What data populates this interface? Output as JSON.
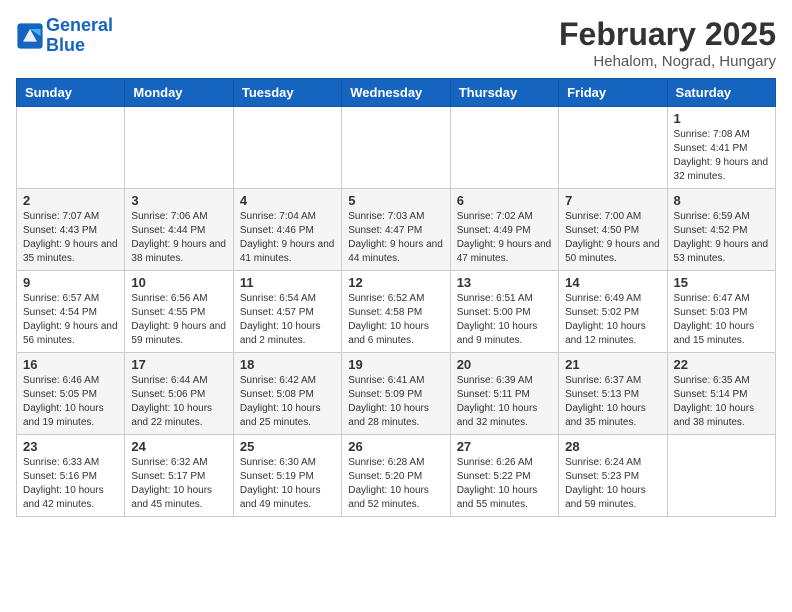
{
  "header": {
    "logo_line1": "General",
    "logo_line2": "Blue",
    "title": "February 2025",
    "subtitle": "Hehalom, Nograd, Hungary"
  },
  "days_of_week": [
    "Sunday",
    "Monday",
    "Tuesday",
    "Wednesday",
    "Thursday",
    "Friday",
    "Saturday"
  ],
  "weeks": [
    [
      {
        "day": "",
        "info": ""
      },
      {
        "day": "",
        "info": ""
      },
      {
        "day": "",
        "info": ""
      },
      {
        "day": "",
        "info": ""
      },
      {
        "day": "",
        "info": ""
      },
      {
        "day": "",
        "info": ""
      },
      {
        "day": "1",
        "info": "Sunrise: 7:08 AM\nSunset: 4:41 PM\nDaylight: 9 hours and 32 minutes."
      }
    ],
    [
      {
        "day": "2",
        "info": "Sunrise: 7:07 AM\nSunset: 4:43 PM\nDaylight: 9 hours and 35 minutes."
      },
      {
        "day": "3",
        "info": "Sunrise: 7:06 AM\nSunset: 4:44 PM\nDaylight: 9 hours and 38 minutes."
      },
      {
        "day": "4",
        "info": "Sunrise: 7:04 AM\nSunset: 4:46 PM\nDaylight: 9 hours and 41 minutes."
      },
      {
        "day": "5",
        "info": "Sunrise: 7:03 AM\nSunset: 4:47 PM\nDaylight: 9 hours and 44 minutes."
      },
      {
        "day": "6",
        "info": "Sunrise: 7:02 AM\nSunset: 4:49 PM\nDaylight: 9 hours and 47 minutes."
      },
      {
        "day": "7",
        "info": "Sunrise: 7:00 AM\nSunset: 4:50 PM\nDaylight: 9 hours and 50 minutes."
      },
      {
        "day": "8",
        "info": "Sunrise: 6:59 AM\nSunset: 4:52 PM\nDaylight: 9 hours and 53 minutes."
      }
    ],
    [
      {
        "day": "9",
        "info": "Sunrise: 6:57 AM\nSunset: 4:54 PM\nDaylight: 9 hours and 56 minutes."
      },
      {
        "day": "10",
        "info": "Sunrise: 6:56 AM\nSunset: 4:55 PM\nDaylight: 9 hours and 59 minutes."
      },
      {
        "day": "11",
        "info": "Sunrise: 6:54 AM\nSunset: 4:57 PM\nDaylight: 10 hours and 2 minutes."
      },
      {
        "day": "12",
        "info": "Sunrise: 6:52 AM\nSunset: 4:58 PM\nDaylight: 10 hours and 6 minutes."
      },
      {
        "day": "13",
        "info": "Sunrise: 6:51 AM\nSunset: 5:00 PM\nDaylight: 10 hours and 9 minutes."
      },
      {
        "day": "14",
        "info": "Sunrise: 6:49 AM\nSunset: 5:02 PM\nDaylight: 10 hours and 12 minutes."
      },
      {
        "day": "15",
        "info": "Sunrise: 6:47 AM\nSunset: 5:03 PM\nDaylight: 10 hours and 15 minutes."
      }
    ],
    [
      {
        "day": "16",
        "info": "Sunrise: 6:46 AM\nSunset: 5:05 PM\nDaylight: 10 hours and 19 minutes."
      },
      {
        "day": "17",
        "info": "Sunrise: 6:44 AM\nSunset: 5:06 PM\nDaylight: 10 hours and 22 minutes."
      },
      {
        "day": "18",
        "info": "Sunrise: 6:42 AM\nSunset: 5:08 PM\nDaylight: 10 hours and 25 minutes."
      },
      {
        "day": "19",
        "info": "Sunrise: 6:41 AM\nSunset: 5:09 PM\nDaylight: 10 hours and 28 minutes."
      },
      {
        "day": "20",
        "info": "Sunrise: 6:39 AM\nSunset: 5:11 PM\nDaylight: 10 hours and 32 minutes."
      },
      {
        "day": "21",
        "info": "Sunrise: 6:37 AM\nSunset: 5:13 PM\nDaylight: 10 hours and 35 minutes."
      },
      {
        "day": "22",
        "info": "Sunrise: 6:35 AM\nSunset: 5:14 PM\nDaylight: 10 hours and 38 minutes."
      }
    ],
    [
      {
        "day": "23",
        "info": "Sunrise: 6:33 AM\nSunset: 5:16 PM\nDaylight: 10 hours and 42 minutes."
      },
      {
        "day": "24",
        "info": "Sunrise: 6:32 AM\nSunset: 5:17 PM\nDaylight: 10 hours and 45 minutes."
      },
      {
        "day": "25",
        "info": "Sunrise: 6:30 AM\nSunset: 5:19 PM\nDaylight: 10 hours and 49 minutes."
      },
      {
        "day": "26",
        "info": "Sunrise: 6:28 AM\nSunset: 5:20 PM\nDaylight: 10 hours and 52 minutes."
      },
      {
        "day": "27",
        "info": "Sunrise: 6:26 AM\nSunset: 5:22 PM\nDaylight: 10 hours and 55 minutes."
      },
      {
        "day": "28",
        "info": "Sunrise: 6:24 AM\nSunset: 5:23 PM\nDaylight: 10 hours and 59 minutes."
      },
      {
        "day": "",
        "info": ""
      }
    ]
  ]
}
